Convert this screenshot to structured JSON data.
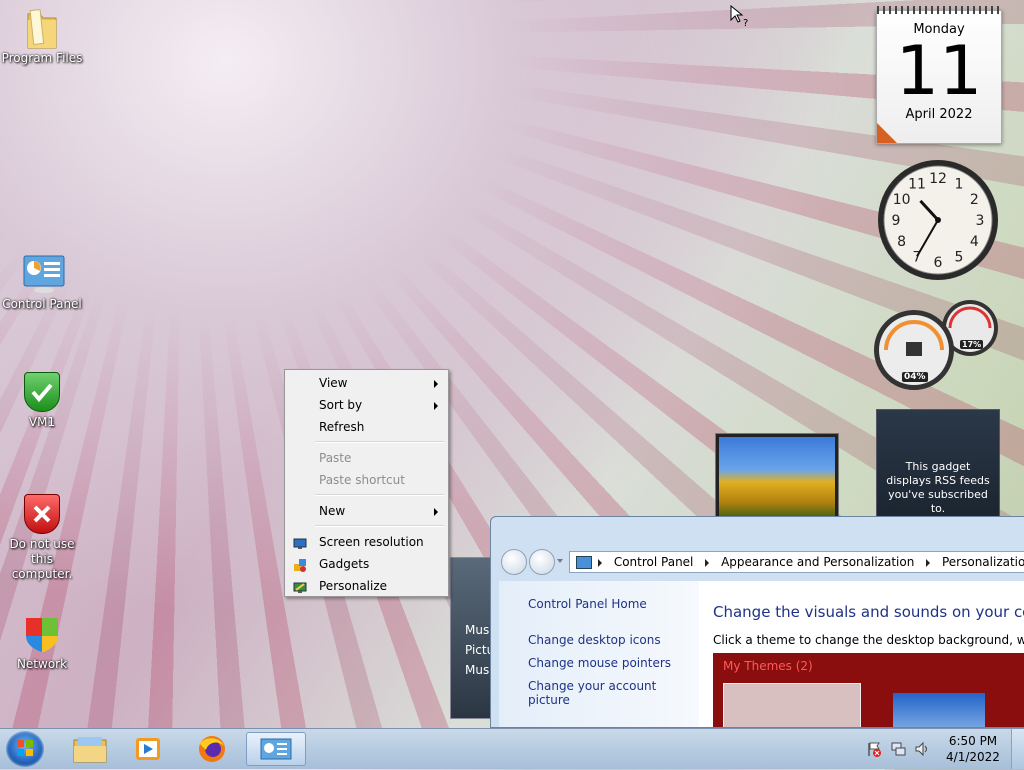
{
  "desktop": {
    "icons": [
      {
        "label": "Program Files",
        "icon": "folder-icon"
      },
      {
        "label": "Control Panel",
        "icon": "control-panel-icon"
      },
      {
        "label": "VM1",
        "icon": "green-shield-icon"
      },
      {
        "label": "Do not use this computer.",
        "icon": "red-shield-icon"
      },
      {
        "label": "Network",
        "icon": "network-icon"
      }
    ]
  },
  "gadgets": {
    "calendar": {
      "weekday": "Monday",
      "day": "11",
      "month_year": "April 2022"
    },
    "clock": {
      "numerals": [
        "12",
        "1",
        "2",
        "3",
        "4",
        "5",
        "6",
        "7",
        "8",
        "9",
        "10",
        "11"
      ],
      "hour": 10,
      "minute": 35
    },
    "cpu_meter": {
      "cpu_label": "04%",
      "memory_label": "17%"
    },
    "rss": {
      "text": "This gadget displays RSS feeds you've subscribed to."
    },
    "picture_stub": {
      "lines": [
        "Mus",
        "Pictu",
        "Mus"
      ]
    }
  },
  "context_menu": {
    "items": [
      {
        "label": "View",
        "submenu": true
      },
      {
        "label": "Sort by",
        "submenu": true
      },
      {
        "label": "Refresh"
      },
      {
        "label": "Paste",
        "disabled": true
      },
      {
        "label": "Paste shortcut",
        "disabled": true
      },
      {
        "label": "New",
        "submenu": true
      },
      {
        "label": "Screen resolution",
        "icon": "monitor-icon"
      },
      {
        "label": "Gadgets",
        "icon": "gadgets-icon"
      },
      {
        "label": "Personalize",
        "icon": "personalize-icon"
      }
    ]
  },
  "window": {
    "breadcrumb": [
      "Control Panel",
      "Appearance and Personalization",
      "Personalization"
    ],
    "sidebar_links": [
      "Control Panel Home",
      "Change desktop icons",
      "Change mouse pointers",
      "Change your account picture"
    ],
    "heading": "Change the visuals and sounds on your com",
    "subtext": "Click a theme to change the desktop background, window",
    "themes_label": "My Themes (2)"
  },
  "taskbar": {
    "pinned": [
      "windows-explorer-icon",
      "media-player-icon",
      "firefox-icon",
      "control-panel-icon"
    ],
    "time": "6:50 PM",
    "date": "4/1/2022"
  }
}
